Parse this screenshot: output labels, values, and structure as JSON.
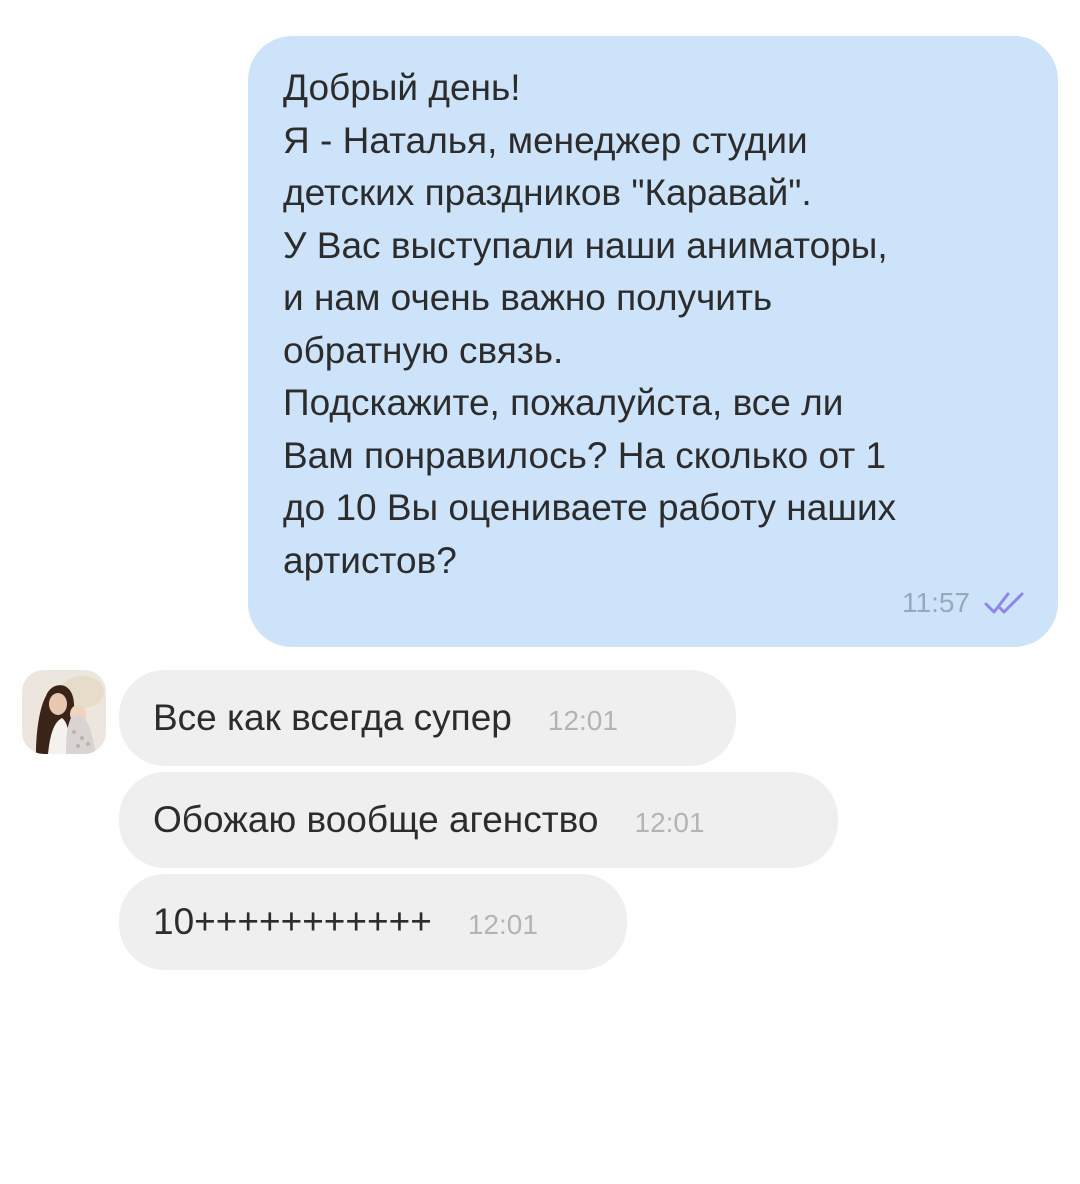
{
  "outgoing_message": {
    "lines": [
      "Добрый день!",
      "Я - Наталья, менеджер студии",
      "детских праздников \"Каравай\".",
      "У Вас выступали наши аниматоры,",
      "и нам очень важно получить",
      "обратную связь.",
      "Подскажите, пожалуйста, все ли",
      "Вам понравилось? На сколько от 1",
      "до 10 Вы оцениваете работу наших",
      "артистов?"
    ],
    "time": "11:57",
    "status_icon": "double-check-icon",
    "background_color": "#cde3fa",
    "check_color": "#8e86e8"
  },
  "incoming_messages": [
    {
      "text": "Все как всегда супер",
      "time": "12:01"
    },
    {
      "text": "Обожаю вообще агенство",
      "time": "12:01"
    },
    {
      "text": "10+++++++++++",
      "time": "12:01"
    }
  ],
  "sender": {
    "avatar_icon": "user-avatar-photo"
  },
  "colors": {
    "incoming_bubble": "#efefef",
    "background": "#ffffff"
  }
}
